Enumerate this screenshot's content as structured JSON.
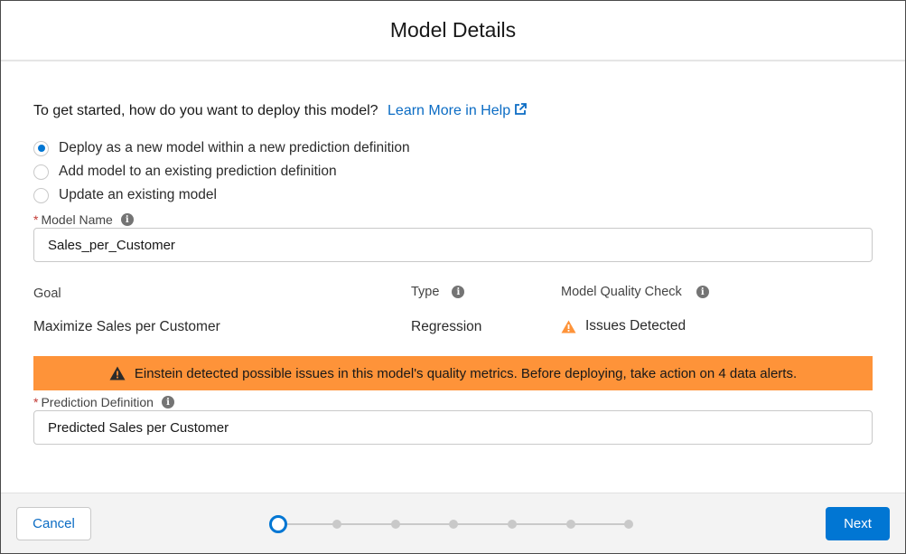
{
  "modal": {
    "title": "Model Details"
  },
  "prompt": {
    "text": "To get started, how do you want to deploy this model?",
    "help_link": "Learn More in Help"
  },
  "deploy_options": [
    {
      "label": "Deploy as a new model within a new prediction definition",
      "checked": true
    },
    {
      "label": "Add model to an existing prediction definition",
      "checked": false
    },
    {
      "label": "Update an existing model",
      "checked": false
    }
  ],
  "model_name": {
    "label": "Model Name",
    "required": true,
    "value": "Sales_per_Customer"
  },
  "summary": {
    "goal_label": "Goal",
    "goal_value": "Maximize Sales per Customer",
    "type_label": "Type",
    "type_value": "Regression",
    "quality_label": "Model Quality Check",
    "quality_value": "Issues Detected"
  },
  "banner": {
    "text": "Einstein detected possible issues in this model's quality metrics. Before deploying, take action on 4 data alerts.",
    "color": "#fe9339"
  },
  "prediction_definition": {
    "label": "Prediction Definition",
    "required": true,
    "value": "Predicted Sales per Customer"
  },
  "footer": {
    "cancel_label": "Cancel",
    "next_label": "Next",
    "steps_total": 7,
    "current_step": 1
  },
  "colors": {
    "brand": "#0176d3",
    "link": "#0b6cc4",
    "warning": "#fe9339",
    "required": "#c23934"
  },
  "icons": {
    "help_link": "external-link-icon",
    "info": "info-icon",
    "warning": "warning-triangle-icon"
  }
}
